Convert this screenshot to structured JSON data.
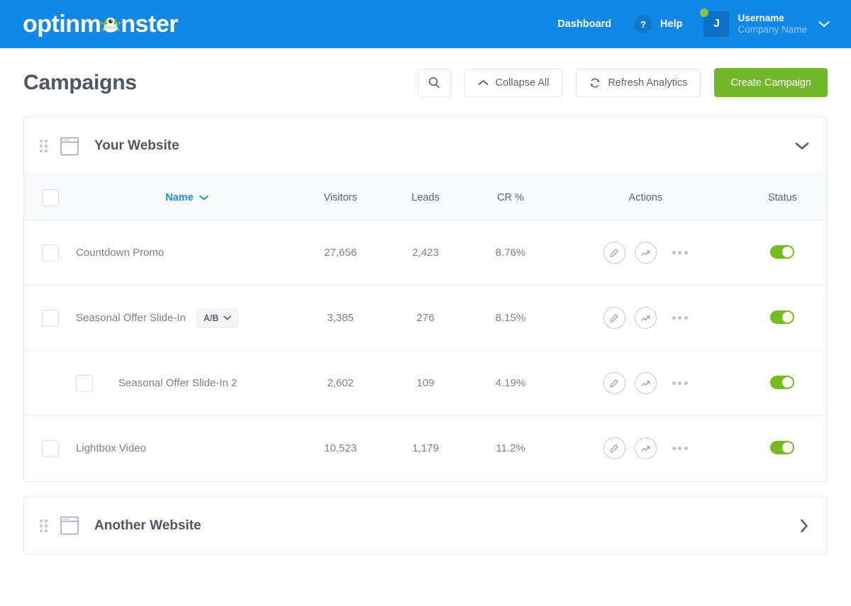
{
  "topbar": {
    "brand": "optinm",
    "brand_tail": "nster",
    "dashboard_label": "Dashboard",
    "help_badge": "?",
    "help_label": "Help",
    "avatar_initial": "J",
    "user_name": "Username",
    "company_name": "Company Name",
    "bg_color": "#1288e6"
  },
  "page": {
    "title": "Campaigns"
  },
  "toolbar": {
    "search_label": "",
    "collapse_label": "Collapse All",
    "refresh_label": "Refresh Analytics",
    "create_label": "Create Campaign",
    "create_color": "#72b62a"
  },
  "table": {
    "columns": {
      "name": "Name",
      "visitors": "Visitors",
      "leads": "Leads",
      "cr": "CR %",
      "actions": "Actions",
      "status": "Status"
    },
    "sort_column": "Name",
    "sort_color": "#1b8ced"
  },
  "panels": [
    {
      "name": "Your Website",
      "expanded": true,
      "rows": [
        {
          "name": "Countdown Promo",
          "visitors": "27,656",
          "leads": "2,423",
          "cr": "8.76%",
          "status_on": true,
          "sub": false,
          "ab_label": null
        },
        {
          "name": "Seasonal Offer Slide-In",
          "visitors": "3,385",
          "leads": "276",
          "cr": "8.15%",
          "status_on": true,
          "sub": false,
          "ab_label": "A/B"
        },
        {
          "name": "Seasonal Offer Slide-In 2",
          "visitors": "2,602",
          "leads": "109",
          "cr": "4.19%",
          "status_on": true,
          "sub": true,
          "ab_label": null
        },
        {
          "name": "Lightbox Video",
          "visitors": "10,523",
          "leads": "1,179",
          "cr": "11.2%",
          "status_on": true,
          "sub": false,
          "ab_label": null
        }
      ]
    },
    {
      "name": "Another Website",
      "expanded": false,
      "rows": []
    }
  ],
  "icons": {
    "search": "search-icon",
    "collapse": "chevron-up-icon",
    "refresh": "refresh-icon",
    "edit": "pencil-icon",
    "analytics": "trend-arrow-icon",
    "more": "more-dots-icon",
    "site": "browser-window-icon",
    "drag": "drag-handle-icon",
    "toggle": "status-toggle"
  }
}
